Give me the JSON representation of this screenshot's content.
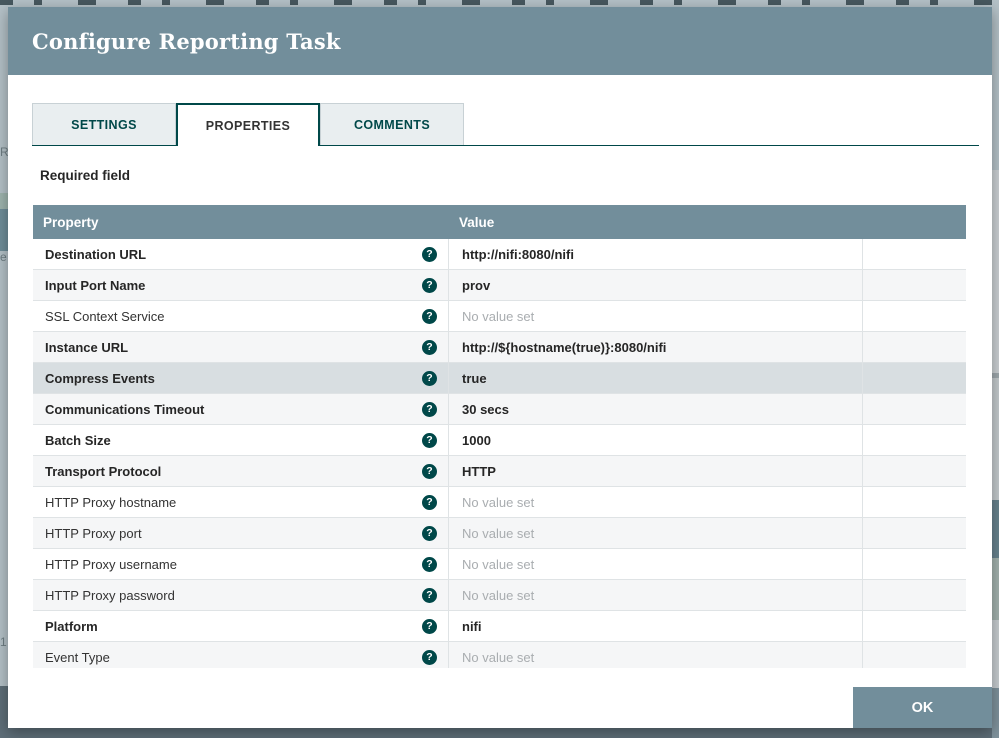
{
  "colors": {
    "header_bg": "#728e9b",
    "accent_teal": "#004849",
    "tab_inactive_bg": "#e9eef0",
    "row_alt_bg": "#f5f6f7",
    "row_highlight_bg": "#d8dee1",
    "unset_text": "#a9adb0",
    "border_light": "#dfe3e5",
    "page_bg": "#b4c1c7",
    "page_bottom": "#5e6e78"
  },
  "background": {
    "letters": [
      "R",
      "e",
      "1"
    ]
  },
  "dialog": {
    "title": "Configure Reporting Task",
    "tabs": [
      {
        "label": "SETTINGS",
        "active": false
      },
      {
        "label": "PROPERTIES",
        "active": true
      },
      {
        "label": "COMMENTS",
        "active": false
      }
    ],
    "required_field_label": "Required field",
    "table": {
      "columns": [
        "Property",
        "Value"
      ],
      "help_glyph": "?",
      "no_value_text": "No value set",
      "rows": [
        {
          "name": "Destination URL",
          "value": "http://nifi:8080/nifi",
          "required": true,
          "set": true,
          "highlighted": false
        },
        {
          "name": "Input Port Name",
          "value": "prov",
          "required": true,
          "set": true,
          "highlighted": false
        },
        {
          "name": "SSL Context Service",
          "value": "No value set",
          "required": false,
          "set": false,
          "highlighted": false
        },
        {
          "name": "Instance URL",
          "value": "http://${hostname(true)}:8080/nifi",
          "required": true,
          "set": true,
          "highlighted": false
        },
        {
          "name": "Compress Events",
          "value": "true",
          "required": true,
          "set": true,
          "highlighted": true
        },
        {
          "name": "Communications Timeout",
          "value": "30 secs",
          "required": true,
          "set": true,
          "highlighted": false
        },
        {
          "name": "Batch Size",
          "value": "1000",
          "required": true,
          "set": true,
          "highlighted": false
        },
        {
          "name": "Transport Protocol",
          "value": "HTTP",
          "required": true,
          "set": true,
          "highlighted": false
        },
        {
          "name": "HTTP Proxy hostname",
          "value": "No value set",
          "required": false,
          "set": false,
          "highlighted": false
        },
        {
          "name": "HTTP Proxy port",
          "value": "No value set",
          "required": false,
          "set": false,
          "highlighted": false
        },
        {
          "name": "HTTP Proxy username",
          "value": "No value set",
          "required": false,
          "set": false,
          "highlighted": false
        },
        {
          "name": "HTTP Proxy password",
          "value": "No value set",
          "required": false,
          "set": false,
          "highlighted": false
        },
        {
          "name": "Platform",
          "value": "nifi",
          "required": true,
          "set": true,
          "highlighted": false
        },
        {
          "name": "Event Type",
          "value": "No value set",
          "required": false,
          "set": false,
          "highlighted": false
        }
      ]
    },
    "ok_button_label": "OK"
  }
}
